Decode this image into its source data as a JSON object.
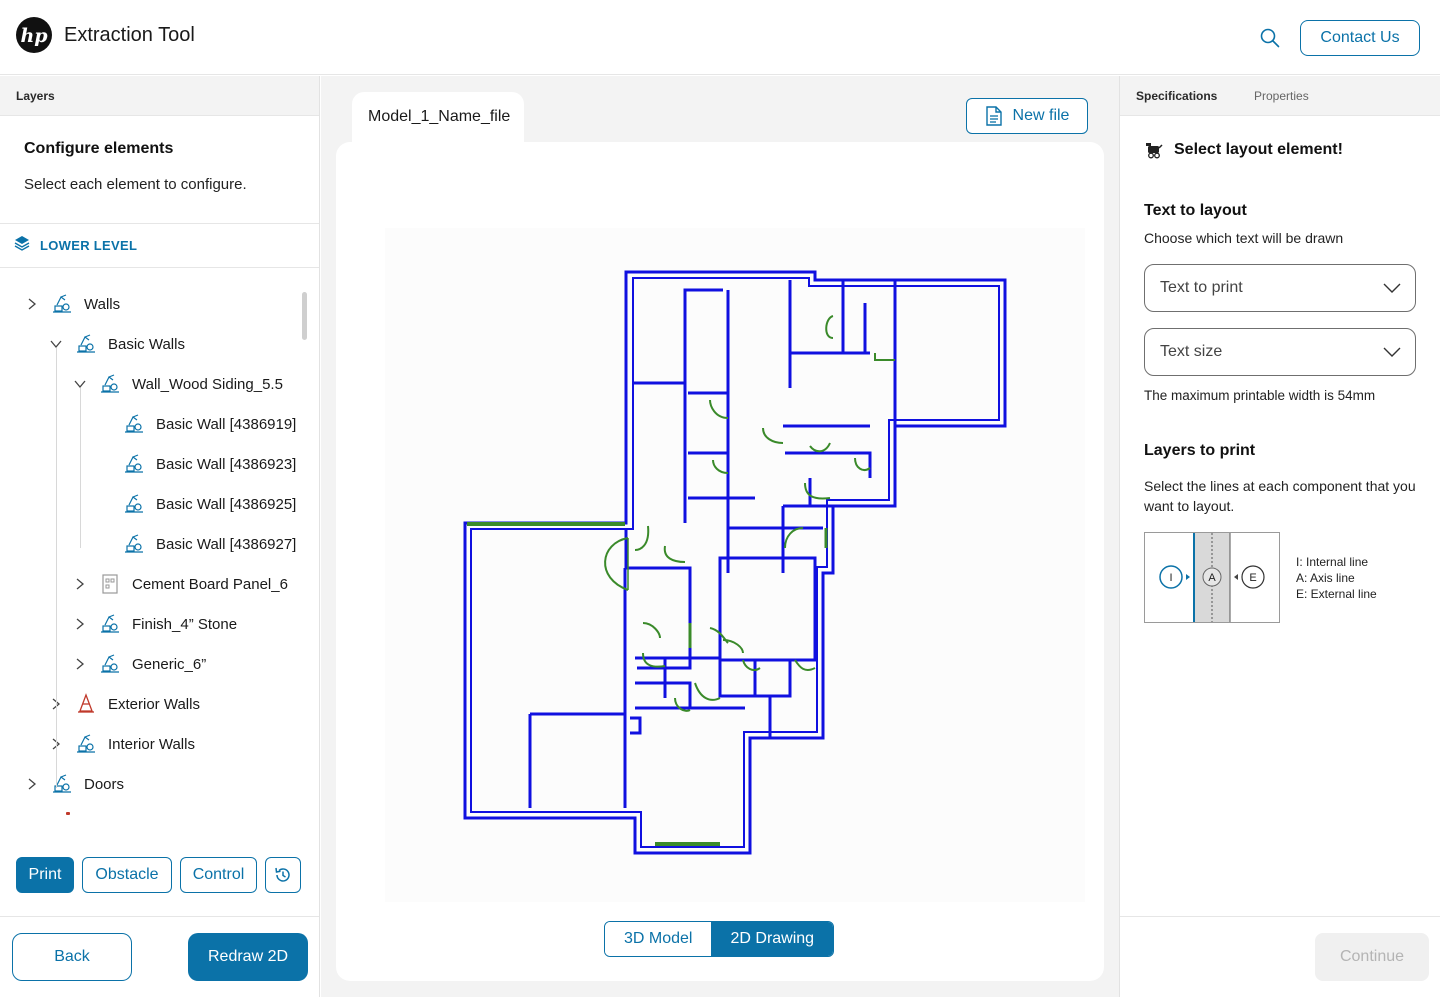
{
  "header": {
    "app_title": "Extraction Tool",
    "contact_label": "Contact Us",
    "logo_text": "hp"
  },
  "left_panel": {
    "tab_label": "Layers",
    "config_title": "Configure elements",
    "config_subtitle": "Select each element to configure.",
    "level_label": "LOWER LEVEL",
    "tree": [
      {
        "label": "Walls",
        "depth": 0,
        "expanded": false,
        "icon": "wall-layer-icon"
      },
      {
        "label": "Basic Walls",
        "depth": 1,
        "expanded": true,
        "icon": "wall-layer-icon"
      },
      {
        "label": "Wall_Wood Siding_5.5",
        "depth": 2,
        "expanded": true,
        "icon": "wall-layer-icon"
      },
      {
        "label": "Basic Wall [4386919]",
        "depth": 3,
        "icon": "wall-layer-icon"
      },
      {
        "label": "Basic Wall [4386923]",
        "depth": 3,
        "icon": "wall-layer-icon"
      },
      {
        "label": "Basic Wall [4386925]",
        "depth": 3,
        "icon": "wall-layer-icon"
      },
      {
        "label": "Basic Wall [4386927]",
        "depth": 3,
        "icon": "wall-layer-icon"
      },
      {
        "label": "Cement Board Panel_6",
        "depth": 2,
        "expanded": false,
        "icon": "panel-icon"
      },
      {
        "label": "Finish_4” Stone",
        "depth": 2,
        "expanded": false,
        "icon": "wall-layer-icon"
      },
      {
        "label": "Generic_6”",
        "depth": 2,
        "expanded": false,
        "icon": "wall-layer-icon"
      },
      {
        "label": "Exterior Walls",
        "depth": 1,
        "expanded": false,
        "icon": "warning-cone-icon"
      },
      {
        "label": "Interior Walls",
        "depth": 1,
        "expanded": false,
        "icon": "wall-layer-icon"
      },
      {
        "label": "Doors",
        "depth": 0,
        "expanded": false,
        "icon": "wall-layer-icon"
      }
    ],
    "mode_buttons": {
      "print": "Print",
      "obstacle": "Obstacle",
      "control": "Control"
    },
    "back_label": "Back",
    "redraw_label": "Redraw 2D"
  },
  "center": {
    "file_tab": "Model_1_Name_file",
    "new_file_label": "New file",
    "view_toggle": {
      "model_3d": "3D Model",
      "drawing_2d": "2D Drawing",
      "active": "2D Drawing"
    }
  },
  "right_panel": {
    "tabs": {
      "specifications": "Specifications",
      "properties": "Properties",
      "active": "Specifications"
    },
    "select_heading": "Select layout element!",
    "text_section_title": "Text to layout",
    "text_section_desc": "Choose which text will be drawn",
    "text_to_print": "Text to print",
    "text_size": "Text size",
    "max_width_note": "The maximum printable width is 54mm",
    "layers_title": "Layers to print",
    "layers_desc": "Select the lines at each component that you want to layout.",
    "legend": {
      "internal_letter": "I",
      "axis_letter": "A",
      "external_letter": "E",
      "internal": "I: Internal line",
      "axis": "A: Axis line",
      "external": "E: External line"
    },
    "continue_label": "Continue"
  },
  "colors": {
    "primary": "#0b72a8",
    "wall_blue": "#1010e0",
    "door_green": "#3a8a2a",
    "alert_red": "#c0392b"
  }
}
